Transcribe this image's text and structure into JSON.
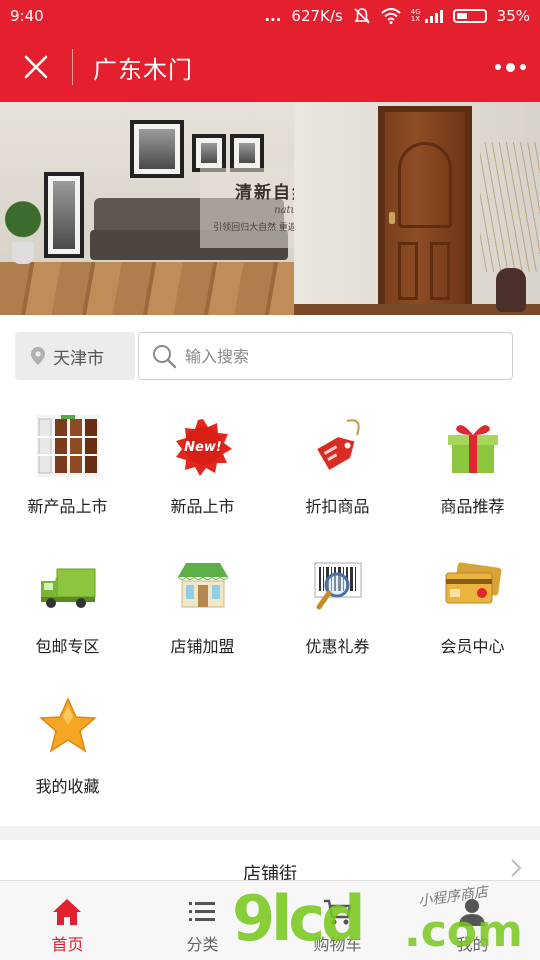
{
  "status_bar": {
    "time": "9:40",
    "dots": "...",
    "network_speed": "627K/s",
    "network_type_top": "4G",
    "network_type_bottom": "1X",
    "battery": "35%"
  },
  "header": {
    "title": "广东木门",
    "close_icon": "close-icon",
    "more_icon": "more-icon",
    "accent_color": "#e5202e"
  },
  "banner": {
    "headline": "清新自然",
    "english": "natural style",
    "tagline": "引领回归大自然  重返原木生活"
  },
  "search": {
    "city": "天津市",
    "placeholder": "输入搜索",
    "value": ""
  },
  "grid": {
    "items": [
      {
        "label": "新产品上市",
        "icon": "door-catalog-icon"
      },
      {
        "label": "新品上市",
        "icon": "new-badge-icon"
      },
      {
        "label": "折扣商品",
        "icon": "price-tag-icon"
      },
      {
        "label": "商品推荐",
        "icon": "gift-box-icon"
      },
      {
        "label": "包邮专区",
        "icon": "delivery-truck-icon"
      },
      {
        "label": "店铺加盟",
        "icon": "storefront-icon"
      },
      {
        "label": "优惠礼券",
        "icon": "barcode-scan-icon"
      },
      {
        "label": "会员中心",
        "icon": "member-card-icon"
      },
      {
        "label": "我的收藏",
        "icon": "star-icon"
      }
    ]
  },
  "street": {
    "title": "店铺街"
  },
  "tabs": [
    {
      "label": "首页",
      "icon": "home-icon",
      "active": true
    },
    {
      "label": "分类",
      "icon": "list-icon",
      "active": false
    },
    {
      "label": "购物车",
      "icon": "cart-icon",
      "active": false
    },
    {
      "label": "我的",
      "icon": "user-icon",
      "active": false
    }
  ],
  "watermark": {
    "main": "9lcd",
    "domain": ".com",
    "sub": "小程序商店"
  }
}
